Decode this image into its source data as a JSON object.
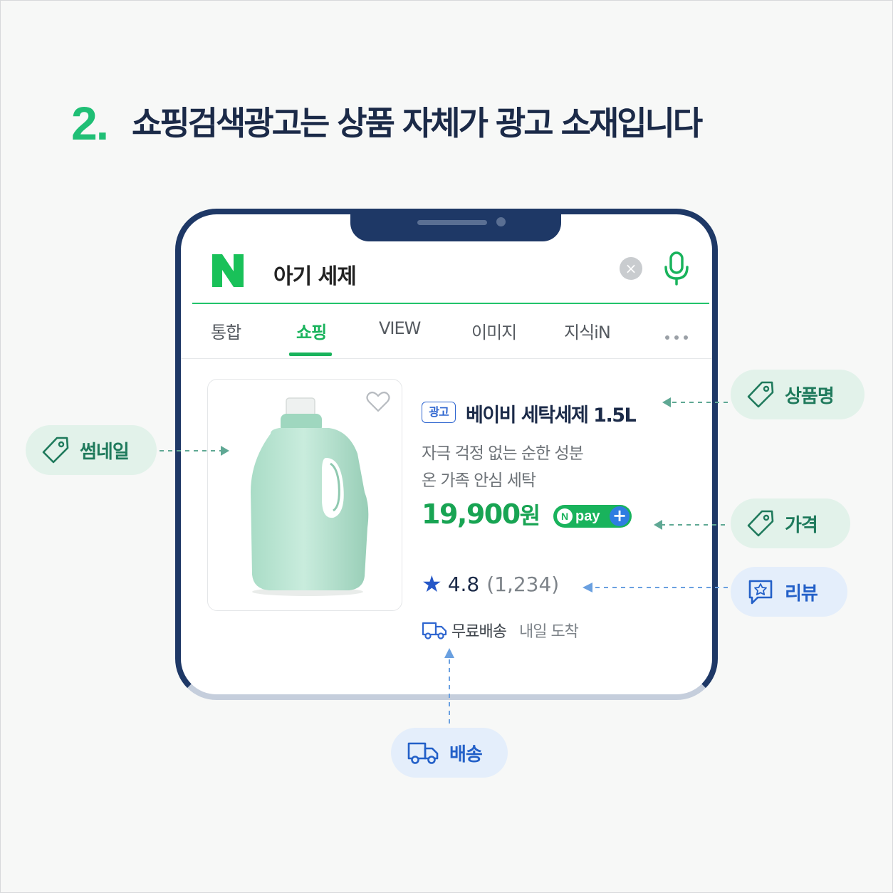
{
  "heading": {
    "number": "2.",
    "title": "쇼핑검색광고는 상품 자체가 광고 소재입니다"
  },
  "search": {
    "logo": "N",
    "query": "아기 세제",
    "clear_icon": "clear-icon",
    "mic_icon": "mic-icon"
  },
  "tabs": [
    {
      "label": "통합",
      "active": false
    },
    {
      "label": "쇼핑",
      "active": true
    },
    {
      "label": "VIEW",
      "active": false
    },
    {
      "label": "이미지",
      "active": false
    },
    {
      "label": "지식iN",
      "active": false
    }
  ],
  "product": {
    "ad_badge": "광고",
    "name": "베이비 세탁세제 1.5L",
    "description": [
      "자극 걱정 없는 순한 성분",
      "온 가족 안심 세탁"
    ],
    "price": "19,900",
    "currency": "원",
    "npay": {
      "n": "N",
      "label": "pay",
      "plus": "+"
    },
    "rating": "4.8",
    "review_count": "(1,234)",
    "shipping": "무료배송",
    "arrival": "내일 도착"
  },
  "callouts": {
    "thumbnail": "썸네일",
    "product_name": "상품명",
    "price": "가격",
    "review": "리뷰",
    "shipping": "배송"
  },
  "colors": {
    "accent_green": "#1fbf75",
    "naver_green": "#19b35c",
    "navy": "#1e3866",
    "blue": "#2360c8"
  }
}
